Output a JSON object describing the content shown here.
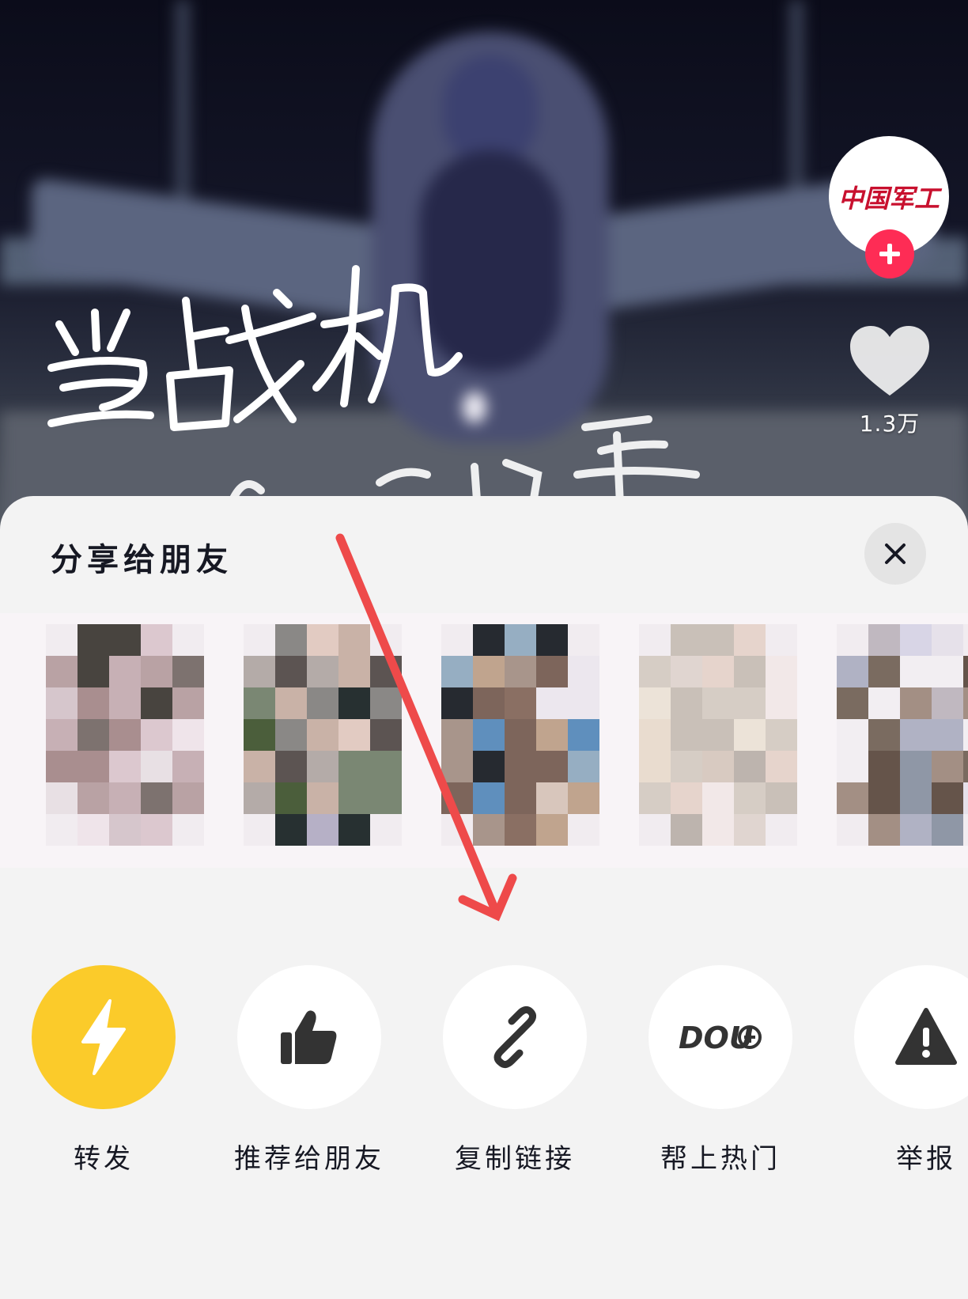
{
  "video": {
    "caption_line1": "当战机",
    "account_logo_text": "中国军工",
    "like_count": "1.3万"
  },
  "share_sheet": {
    "title": "分享给朋友",
    "friends_count_visible": 5,
    "actions": [
      {
        "label": "转发",
        "icon": "lightning-icon",
        "bg": "#fbcb2a"
      },
      {
        "label": "推荐给朋友",
        "icon": "thumbs-up-icon",
        "bg": "#ffffff"
      },
      {
        "label": "复制链接",
        "icon": "link-icon",
        "bg": "#ffffff"
      },
      {
        "label": "帮上热门",
        "icon": "dou-plus-icon",
        "bg": "#ffffff",
        "icon_text": "DOU"
      },
      {
        "label": "举报",
        "icon": "warning-icon",
        "bg": "#ffffff"
      }
    ]
  },
  "colors": {
    "accent_red": "#fe2c55",
    "forward_yellow": "#fbcb2a",
    "annotation_arrow": "#ee4a4a",
    "sheet_bg": "#f3f3f3"
  }
}
